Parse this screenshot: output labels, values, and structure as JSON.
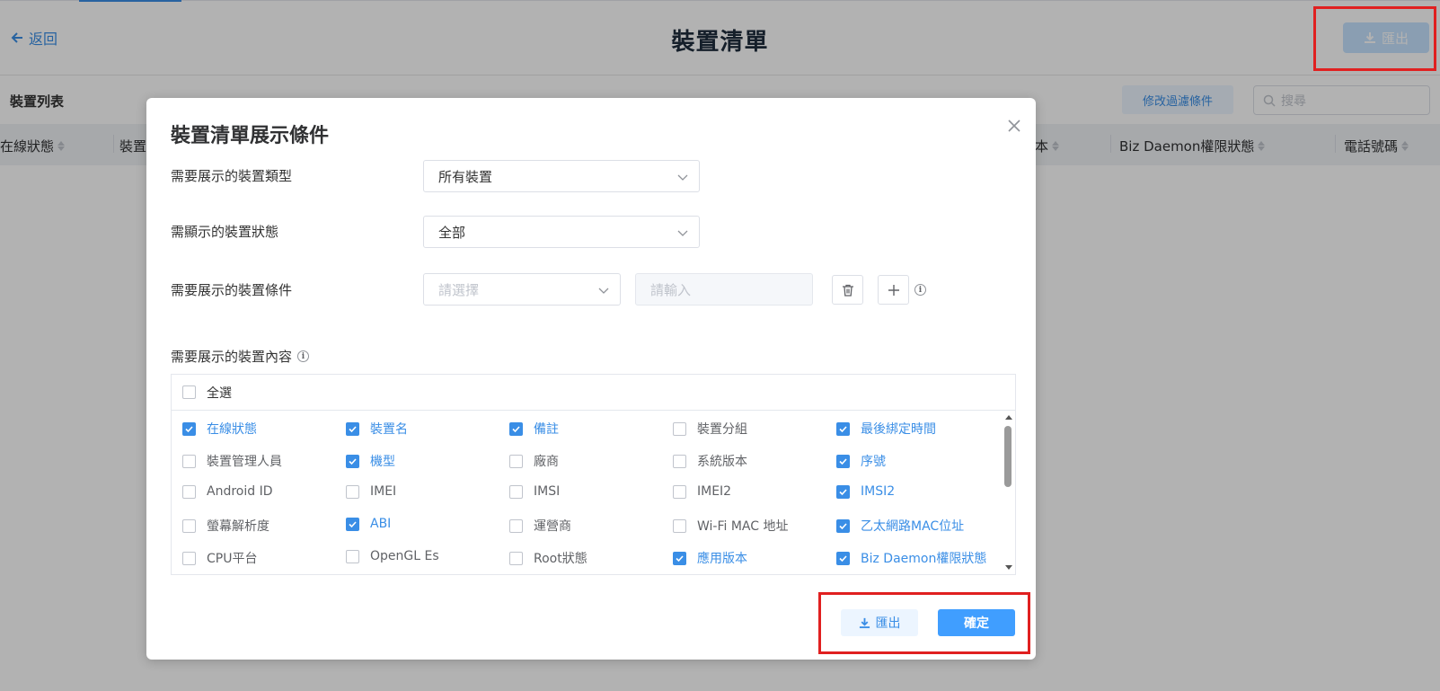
{
  "header": {
    "back_label": "返回",
    "title": "裝置清單",
    "export_label": "匯出"
  },
  "list": {
    "title": "裝置列表",
    "filter_button": "修改過濾條件",
    "search_placeholder": "搜尋",
    "columns": [
      {
        "label": "在線狀態"
      },
      {
        "label": "裝置"
      },
      {
        "label": "本"
      },
      {
        "label": "Biz Daemon權限狀態"
      },
      {
        "label": "電話號碼"
      }
    ]
  },
  "dialog": {
    "title": "裝置清單展示條件",
    "device_type_label": "需要展示的裝置類型",
    "device_type_value": "所有裝置",
    "device_status_label": "需顯示的裝置狀態",
    "device_status_value": "全部",
    "condition_label": "需要展示的裝置條件",
    "condition_select_placeholder": "請選擇",
    "condition_input_placeholder": "請輸入",
    "content_label": "需要展示的裝置內容",
    "select_all_label": "全選",
    "select_all_checked": false,
    "fields": [
      {
        "label": "在線狀態",
        "checked": true
      },
      {
        "label": "裝置名",
        "checked": true
      },
      {
        "label": "備註",
        "checked": true
      },
      {
        "label": "裝置分組",
        "checked": false
      },
      {
        "label": "最後綁定時間",
        "checked": true
      },
      {
        "label": "裝置管理人員",
        "checked": false
      },
      {
        "label": "機型",
        "checked": true
      },
      {
        "label": "廠商",
        "checked": false
      },
      {
        "label": "系統版本",
        "checked": false
      },
      {
        "label": "序號",
        "checked": true
      },
      {
        "label": "Android ID",
        "checked": false
      },
      {
        "label": "IMEI",
        "checked": false
      },
      {
        "label": "IMSI",
        "checked": false
      },
      {
        "label": "IMEI2",
        "checked": false
      },
      {
        "label": "IMSI2",
        "checked": true
      },
      {
        "label": "螢幕解析度",
        "checked": false
      },
      {
        "label": "ABI",
        "checked": true
      },
      {
        "label": "運營商",
        "checked": false
      },
      {
        "label": "Wi-Fi MAC 地址",
        "checked": false
      },
      {
        "label": "乙太網路MAC位址",
        "checked": true
      },
      {
        "label": "CPU平台",
        "checked": false
      },
      {
        "label": "OpenGL Es",
        "checked": false
      },
      {
        "label": "Root狀態",
        "checked": false
      },
      {
        "label": "應用版本",
        "checked": true
      },
      {
        "label": "Biz Daemon權限狀態",
        "checked": true
      }
    ],
    "export_label": "匯出",
    "confirm_label": "確定"
  },
  "colors": {
    "accent": "#409eff",
    "highlight": "#e02020"
  }
}
